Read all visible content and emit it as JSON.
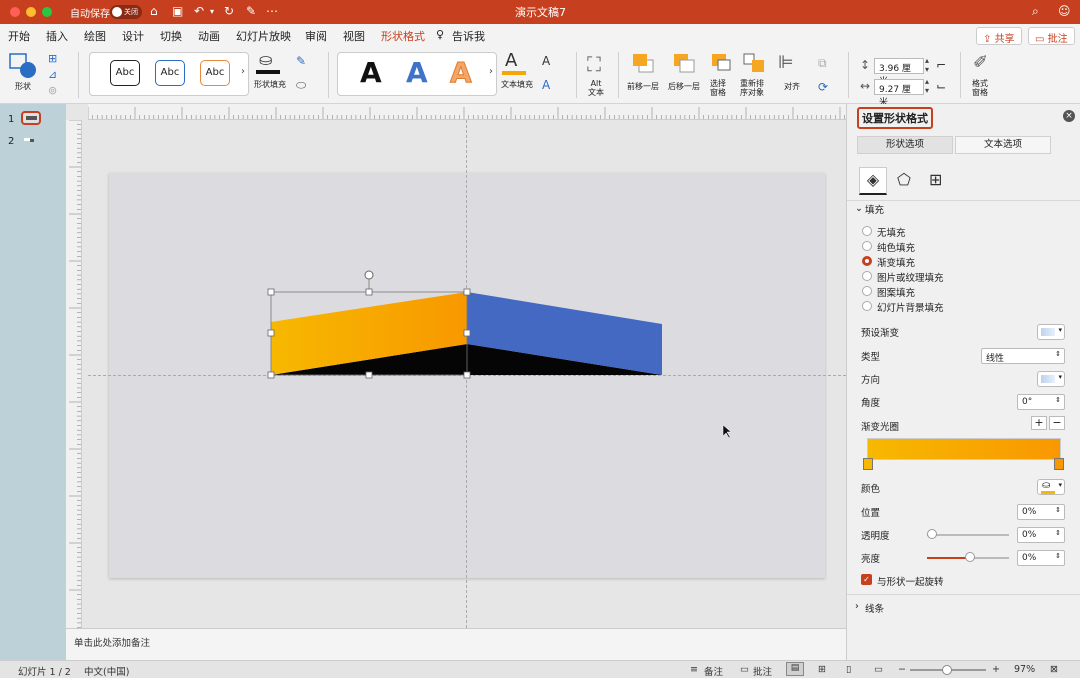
{
  "titlebar": {
    "autosave_label": "自动保存",
    "autosave_state": "关闭",
    "doc_title": "演示文稿7"
  },
  "menu": {
    "items": [
      "开始",
      "插入",
      "绘图",
      "设计",
      "切换",
      "动画",
      "幻灯片放映",
      "审阅",
      "视图",
      "形状格式",
      "告诉我"
    ],
    "share": "共享",
    "comments": "批注"
  },
  "ribbon": {
    "shape_label": "形状",
    "style_box_text": "Abc",
    "shape_fill_label": "形状填充",
    "wordart_letter": "A",
    "text_fill_label": "文本填充",
    "alt_text_label": "Alt\n文本",
    "bring_forward": "前移一层",
    "send_backward": "后移一层",
    "selection_pane": "选择\n窗格",
    "reorder": "重新排\n序对象",
    "align": "对齐",
    "height_value": "3.96 厘米",
    "width_value": "9.27 厘米",
    "format_pane_label": "格式\n窗格"
  },
  "thumbnails": [
    "1",
    "2"
  ],
  "notes_placeholder": "单击此处添加备注",
  "pane": {
    "title": "设置形状格式",
    "tab_shape": "形状选项",
    "tab_text": "文本选项",
    "fill_section": "填充",
    "fill_options": [
      "无填充",
      "纯色填充",
      "渐变填充",
      "图片或纹理填充",
      "图案填充",
      "幻灯片背景填充"
    ],
    "fill_selected_index": 2,
    "preset_gradient_label": "预设渐变",
    "type_label": "类型",
    "type_value": "线性",
    "direction_label": "方向",
    "angle_label": "角度",
    "angle_value": "0°",
    "stops_label": "渐变光圈",
    "color_label": "颜色",
    "position_label": "位置",
    "position_value": "0%",
    "transparency_label": "透明度",
    "transparency_value": "0%",
    "brightness_label": "亮度",
    "brightness_value": "0%",
    "rotate_with_shape": "与形状一起旋转",
    "line_section": "线条"
  },
  "status": {
    "slide_count": "幻灯片 1 / 2",
    "language": "中文(中国)",
    "notes_btn": "备注",
    "comments_btn": "批注",
    "zoom": "97%"
  },
  "colors": {
    "accent": "#c6401f",
    "gradient_start": "#f7b800",
    "gradient_end": "#f89800",
    "blue_shape": "#4369c3"
  }
}
